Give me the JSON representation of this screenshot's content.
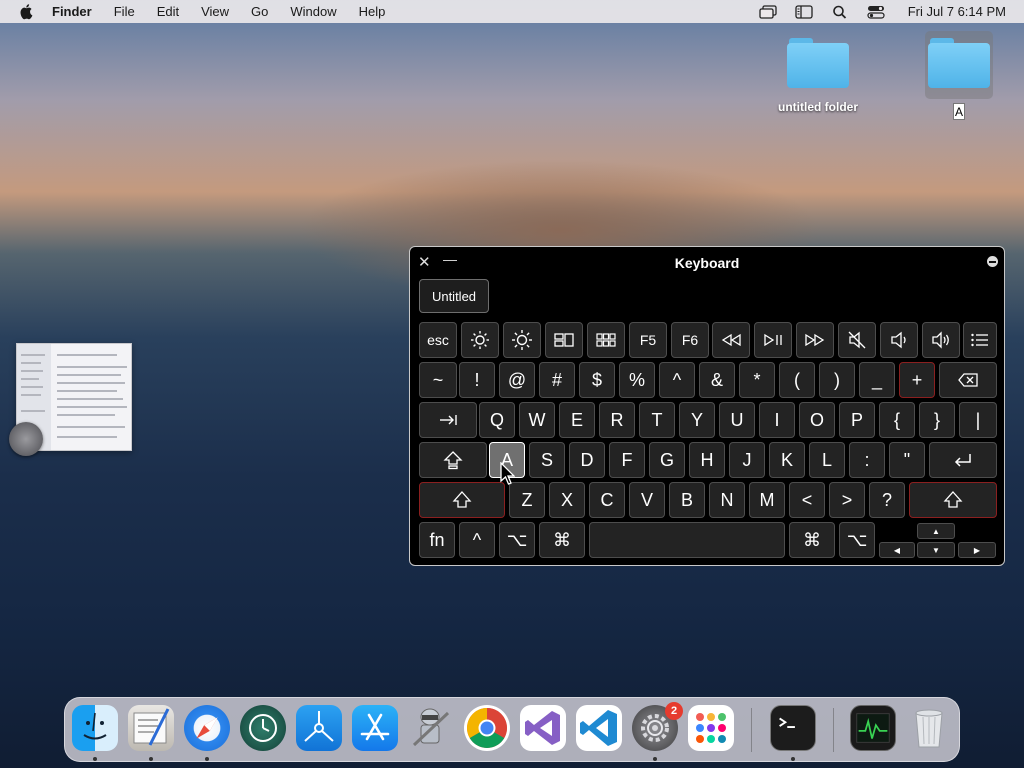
{
  "menubar": {
    "app_name": "Finder",
    "menus": [
      "File",
      "Edit",
      "View",
      "Go",
      "Window",
      "Help"
    ],
    "clock": "Fri Jul 7  6:14 PM",
    "status_icons": [
      "screen-mirroring-icon",
      "sidebar-icon",
      "search-icon",
      "control-center-icon"
    ]
  },
  "desktop": {
    "folder1_label": "untitled folder",
    "folder2_rename_value": "A"
  },
  "keyboard_viewer": {
    "title": "Keyboard",
    "input_source_button": "Untitled",
    "rows": {
      "function": [
        "esc",
        "brightness-down-icon",
        "brightness-up-icon",
        "mission-control-icon",
        "launchpad-icon",
        "F5",
        "F6",
        "rewind-icon",
        "play-pause-icon",
        "fast-forward-icon",
        "mute-icon",
        "volume-down-icon",
        "volume-up-icon",
        "list-icon"
      ],
      "number": [
        "~",
        "!",
        "@",
        "#",
        "$",
        "%",
        "^",
        "&",
        "*",
        "(",
        ")",
        "_",
        "+",
        "delete-icon"
      ],
      "top": [
        "tab-icon",
        "Q",
        "W",
        "E",
        "R",
        "T",
        "Y",
        "U",
        "I",
        "O",
        "P",
        "{",
        "}",
        "|"
      ],
      "home": [
        "caps-lock-icon",
        "A",
        "S",
        "D",
        "F",
        "G",
        "H",
        "J",
        "K",
        "L",
        ":",
        "\"",
        "return-icon"
      ],
      "bottom": [
        "shift-icon",
        "Z",
        "X",
        "C",
        "V",
        "B",
        "N",
        "M",
        "<",
        ">",
        "?",
        "shift-icon"
      ],
      "modifier": [
        "fn",
        "^",
        "⌥",
        "⌘",
        "",
        "⌘",
        "⌥"
      ]
    },
    "pressed_key": "A"
  },
  "dock": {
    "apps": [
      "Finder",
      "Script Editor",
      "Safari",
      "Time Machine",
      "Instruments",
      "App Store",
      "Automator",
      "Chrome",
      "Visual Studio",
      "VS Code",
      "System Preferences",
      "Launchpad",
      "Terminal",
      "Activity Monitor",
      "Trash"
    ],
    "badge_count": "2"
  },
  "colors": {
    "accent_red": "#8b2020",
    "badge_red": "#e63b2e",
    "folder_blue": "#5cb8e8"
  }
}
